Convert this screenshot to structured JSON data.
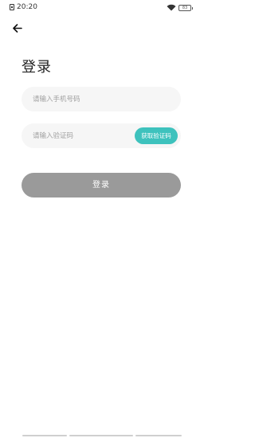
{
  "status_bar": {
    "time": "20:20",
    "battery": "83"
  },
  "page": {
    "title": "登录"
  },
  "phone_input": {
    "placeholder": "请输入手机号码",
    "value": ""
  },
  "code_input": {
    "placeholder": "请输入验证码",
    "value": ""
  },
  "get_code_button": {
    "label": "获取验证码"
  },
  "login_button": {
    "label": "登录"
  },
  "colors": {
    "accent": "#3ec2bd",
    "login_disabled": "#9a9a9a",
    "field_bg": "#f6f6f6"
  },
  "icons": {
    "back": "arrow-left-icon",
    "wifi": "wifi-icon",
    "battery": "battery-icon",
    "sim": "sim-icon"
  }
}
